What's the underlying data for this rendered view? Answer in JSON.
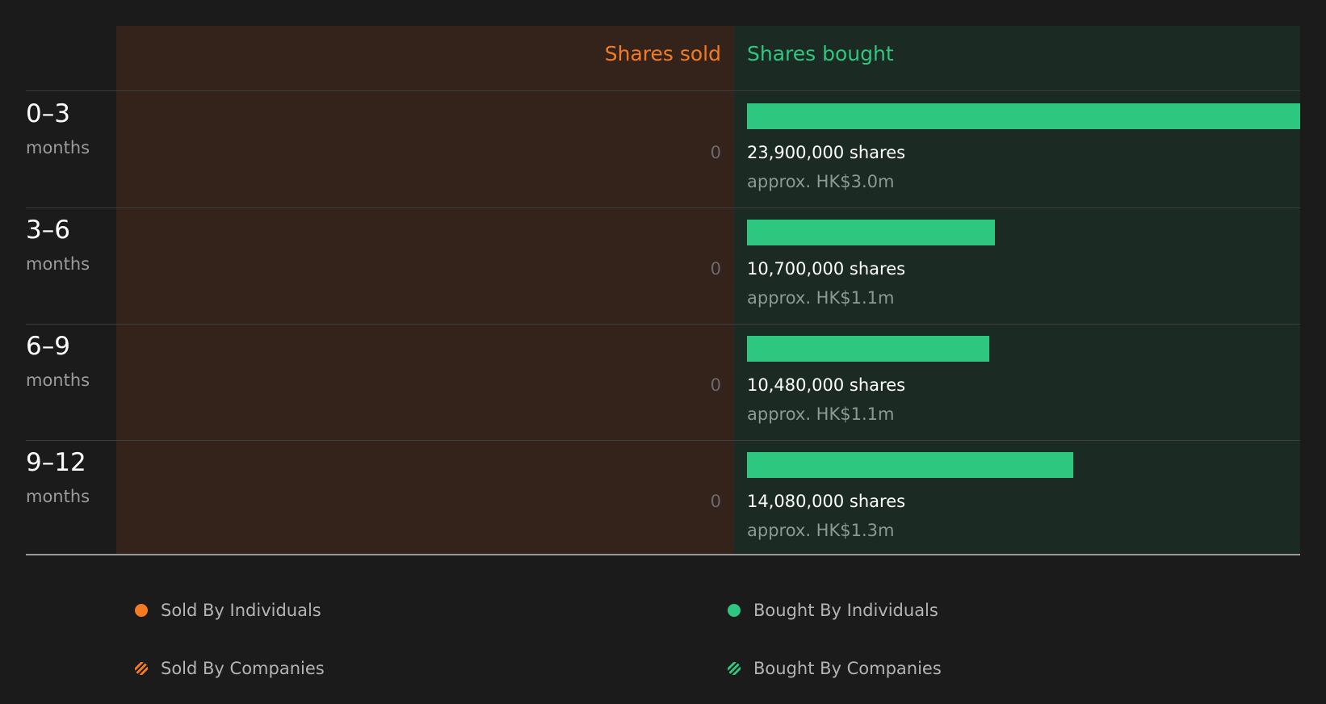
{
  "chart_data": {
    "type": "bar",
    "headers": {
      "sold": "Shares sold",
      "bought": "Shares bought"
    },
    "categories": [
      {
        "range": "0–3",
        "unit": "months"
      },
      {
        "range": "3–6",
        "unit": "months"
      },
      {
        "range": "6–9",
        "unit": "months"
      },
      {
        "range": "9–12",
        "unit": "months"
      }
    ],
    "sold": {
      "values": [
        0,
        0,
        0,
        0
      ],
      "labels": [
        "0",
        "0",
        "0",
        "0"
      ]
    },
    "bought": {
      "values": [
        23900000,
        10700000,
        10480000,
        14080000
      ],
      "share_labels": [
        "23,900,000 shares",
        "10,700,000 shares",
        "10,480,000 shares",
        "14,080,000 shares"
      ],
      "value_labels": [
        "approx. HK$3.0m",
        "approx. HK$1.1m",
        "approx. HK$1.1m",
        "approx. HK$1.3m"
      ]
    },
    "xlim": [
      0,
      23900000
    ],
    "legend": {
      "placement": "bottom",
      "items": [
        {
          "label": "Sold By Individuals",
          "color": "#f47b20",
          "style": "solid"
        },
        {
          "label": "Bought By Individuals",
          "color": "#2ec77f",
          "style": "solid"
        },
        {
          "label": "Sold By Companies",
          "color": "#f47b20",
          "style": "hatched"
        },
        {
          "label": "Bought By Companies",
          "color": "#2ec77f",
          "style": "hatched"
        }
      ]
    },
    "colors": {
      "sold": "#f47b20",
      "bought": "#2ec77f",
      "sold_bg": "#33231b",
      "bought_bg": "#1b2b24"
    }
  }
}
